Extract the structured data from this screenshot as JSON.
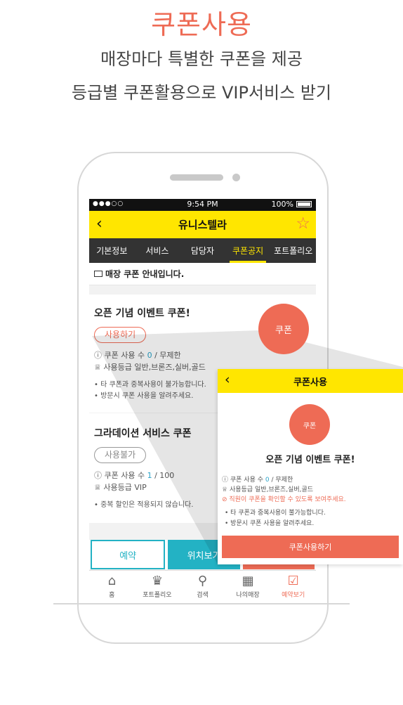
{
  "hero": {
    "title": "쿠폰사용",
    "line1": "매장마다 특별한 쿠폰을 제공",
    "line2": "등급별 쿠폰활용으로 VIP서비스 받기"
  },
  "status": {
    "signal": "●●●○○",
    "time": "9:54 PM",
    "battery": "100%"
  },
  "appbar": {
    "title": "유니스텔라",
    "back": "‹",
    "star": "☆"
  },
  "tabs": [
    {
      "label": "기본정보"
    },
    {
      "label": "서비스"
    },
    {
      "label": "담당자"
    },
    {
      "label": "쿠폰공지",
      "active": true
    },
    {
      "label": "포트폴리오"
    }
  ],
  "notice": {
    "text": "매장 쿠폰 안내입니다."
  },
  "coupons": [
    {
      "title": "오픈 기념 이벤트 쿠폰!",
      "button": "사용하기",
      "usage_label": "쿠폰 사용 수",
      "usage_count": "0",
      "usage_limit": "/ 무제한",
      "grade_label": "사용등급",
      "grade_value": "일반,브론즈,실버,골드",
      "notes": [
        "타 쿠폰과 중복사용이 불가능합니다.",
        "방문시 쿠폰 사용을 알려주세요."
      ]
    },
    {
      "title": "그라데이션 서비스 쿠폰",
      "button": "사용불가",
      "usage_label": "쿠폰 사용 수",
      "usage_count": "1",
      "usage_limit": "/ 100",
      "grade_label": "사용등급",
      "grade_value": "VIP",
      "notes": [
        "중복 할인은 적용되지 않습니다."
      ]
    }
  ],
  "float_badge": "쿠폰",
  "bottom": {
    "reserve": "예약",
    "location": "위치보기"
  },
  "nav": [
    {
      "label": "홈",
      "icon": "home-icon",
      "glyph": "⌂"
    },
    {
      "label": "포트폴리오",
      "icon": "crown-icon",
      "glyph": "♛"
    },
    {
      "label": "검색",
      "icon": "search-icon",
      "glyph": "⚲"
    },
    {
      "label": "나의매장",
      "icon": "store-icon",
      "glyph": "▦"
    },
    {
      "label": "예약보기",
      "icon": "calendar-check-icon",
      "glyph": "☑",
      "active": true
    }
  ],
  "popup": {
    "title": "쿠폰사용",
    "back": "‹",
    "badge": "쿠폰",
    "coupon_title": "오픈 기념 이벤트 쿠폰!",
    "usage_label": "쿠폰 사용 수",
    "usage_count": "0",
    "usage_limit": "/ 무제한",
    "grade_label": "사용등급",
    "grade_value": "일반,브론즈,실버,골드",
    "warning": "직원이 쿠폰을 확인할 수 있도록 보여주세요.",
    "notes": [
      "타 쿠폰과 중복사용이 불가능합니다.",
      "방문시 쿠폰 사용을 알려주세요."
    ],
    "button": "쿠폰사용하기"
  },
  "colors": {
    "accent": "#ee6b55",
    "yellow": "#ffe600",
    "teal": "#23b2c4",
    "dark": "#333333"
  }
}
